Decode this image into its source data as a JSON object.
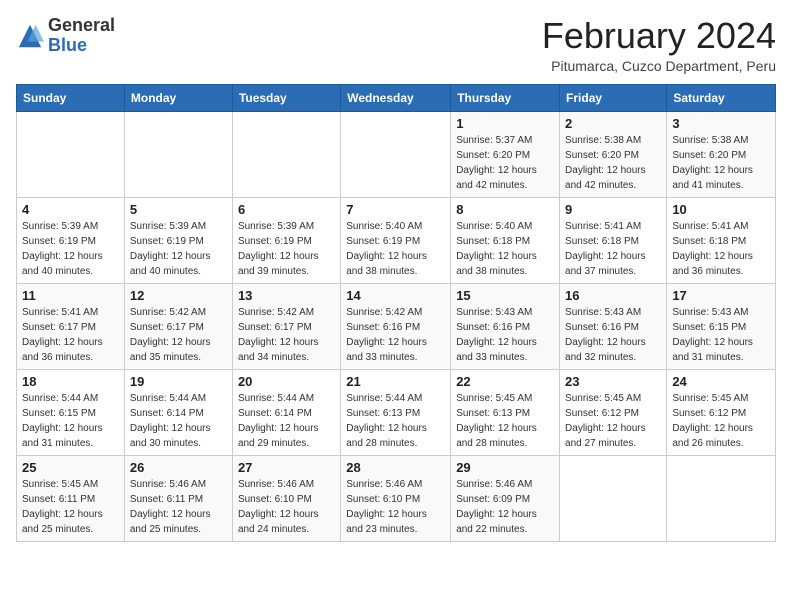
{
  "logo": {
    "general": "General",
    "blue": "Blue"
  },
  "header": {
    "month": "February 2024",
    "location": "Pitumarca, Cuzco Department, Peru"
  },
  "days_of_week": [
    "Sunday",
    "Monday",
    "Tuesday",
    "Wednesday",
    "Thursday",
    "Friday",
    "Saturday"
  ],
  "weeks": [
    [
      {
        "day": "",
        "info": ""
      },
      {
        "day": "",
        "info": ""
      },
      {
        "day": "",
        "info": ""
      },
      {
        "day": "",
        "info": ""
      },
      {
        "day": "1",
        "info": "Sunrise: 5:37 AM\nSunset: 6:20 PM\nDaylight: 12 hours\nand 42 minutes."
      },
      {
        "day": "2",
        "info": "Sunrise: 5:38 AM\nSunset: 6:20 PM\nDaylight: 12 hours\nand 42 minutes."
      },
      {
        "day": "3",
        "info": "Sunrise: 5:38 AM\nSunset: 6:20 PM\nDaylight: 12 hours\nand 41 minutes."
      }
    ],
    [
      {
        "day": "4",
        "info": "Sunrise: 5:39 AM\nSunset: 6:19 PM\nDaylight: 12 hours\nand 40 minutes."
      },
      {
        "day": "5",
        "info": "Sunrise: 5:39 AM\nSunset: 6:19 PM\nDaylight: 12 hours\nand 40 minutes."
      },
      {
        "day": "6",
        "info": "Sunrise: 5:39 AM\nSunset: 6:19 PM\nDaylight: 12 hours\nand 39 minutes."
      },
      {
        "day": "7",
        "info": "Sunrise: 5:40 AM\nSunset: 6:19 PM\nDaylight: 12 hours\nand 38 minutes."
      },
      {
        "day": "8",
        "info": "Sunrise: 5:40 AM\nSunset: 6:18 PM\nDaylight: 12 hours\nand 38 minutes."
      },
      {
        "day": "9",
        "info": "Sunrise: 5:41 AM\nSunset: 6:18 PM\nDaylight: 12 hours\nand 37 minutes."
      },
      {
        "day": "10",
        "info": "Sunrise: 5:41 AM\nSunset: 6:18 PM\nDaylight: 12 hours\nand 36 minutes."
      }
    ],
    [
      {
        "day": "11",
        "info": "Sunrise: 5:41 AM\nSunset: 6:17 PM\nDaylight: 12 hours\nand 36 minutes."
      },
      {
        "day": "12",
        "info": "Sunrise: 5:42 AM\nSunset: 6:17 PM\nDaylight: 12 hours\nand 35 minutes."
      },
      {
        "day": "13",
        "info": "Sunrise: 5:42 AM\nSunset: 6:17 PM\nDaylight: 12 hours\nand 34 minutes."
      },
      {
        "day": "14",
        "info": "Sunrise: 5:42 AM\nSunset: 6:16 PM\nDaylight: 12 hours\nand 33 minutes."
      },
      {
        "day": "15",
        "info": "Sunrise: 5:43 AM\nSunset: 6:16 PM\nDaylight: 12 hours\nand 33 minutes."
      },
      {
        "day": "16",
        "info": "Sunrise: 5:43 AM\nSunset: 6:16 PM\nDaylight: 12 hours\nand 32 minutes."
      },
      {
        "day": "17",
        "info": "Sunrise: 5:43 AM\nSunset: 6:15 PM\nDaylight: 12 hours\nand 31 minutes."
      }
    ],
    [
      {
        "day": "18",
        "info": "Sunrise: 5:44 AM\nSunset: 6:15 PM\nDaylight: 12 hours\nand 31 minutes."
      },
      {
        "day": "19",
        "info": "Sunrise: 5:44 AM\nSunset: 6:14 PM\nDaylight: 12 hours\nand 30 minutes."
      },
      {
        "day": "20",
        "info": "Sunrise: 5:44 AM\nSunset: 6:14 PM\nDaylight: 12 hours\nand 29 minutes."
      },
      {
        "day": "21",
        "info": "Sunrise: 5:44 AM\nSunset: 6:13 PM\nDaylight: 12 hours\nand 28 minutes."
      },
      {
        "day": "22",
        "info": "Sunrise: 5:45 AM\nSunset: 6:13 PM\nDaylight: 12 hours\nand 28 minutes."
      },
      {
        "day": "23",
        "info": "Sunrise: 5:45 AM\nSunset: 6:12 PM\nDaylight: 12 hours\nand 27 minutes."
      },
      {
        "day": "24",
        "info": "Sunrise: 5:45 AM\nSunset: 6:12 PM\nDaylight: 12 hours\nand 26 minutes."
      }
    ],
    [
      {
        "day": "25",
        "info": "Sunrise: 5:45 AM\nSunset: 6:11 PM\nDaylight: 12 hours\nand 25 minutes."
      },
      {
        "day": "26",
        "info": "Sunrise: 5:46 AM\nSunset: 6:11 PM\nDaylight: 12 hours\nand 25 minutes."
      },
      {
        "day": "27",
        "info": "Sunrise: 5:46 AM\nSunset: 6:10 PM\nDaylight: 12 hours\nand 24 minutes."
      },
      {
        "day": "28",
        "info": "Sunrise: 5:46 AM\nSunset: 6:10 PM\nDaylight: 12 hours\nand 23 minutes."
      },
      {
        "day": "29",
        "info": "Sunrise: 5:46 AM\nSunset: 6:09 PM\nDaylight: 12 hours\nand 22 minutes."
      },
      {
        "day": "",
        "info": ""
      },
      {
        "day": "",
        "info": ""
      }
    ]
  ]
}
